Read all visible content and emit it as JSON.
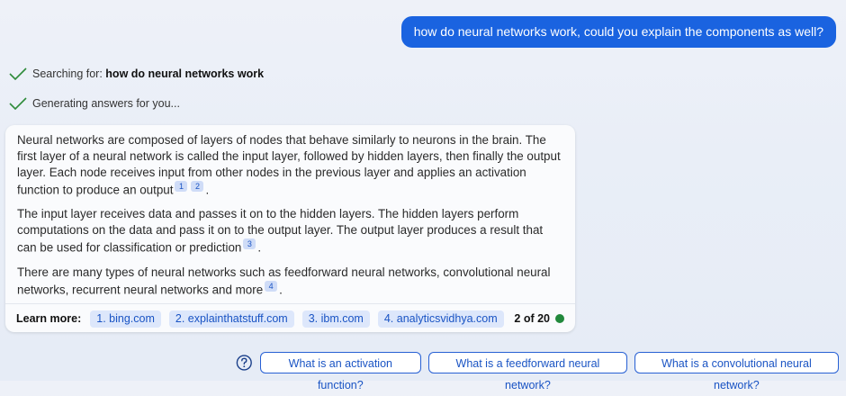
{
  "user_message": "how do neural networks work, could you explain the components as well?",
  "status": {
    "searching_prefix": "Searching for: ",
    "searching_query": "how do neural networks work",
    "generating": "Generating answers for you..."
  },
  "answer": {
    "p1": "Neural networks are composed of layers of nodes that behave similarly to neurons in the brain. The first layer of a neural network is called the input layer, followed by hidden layers, then finally the output layer. Each node receives input from other nodes in the previous layer and applies an activation function to produce an output",
    "p1_cites": [
      "1",
      "2"
    ],
    "p2": "The input layer receives data and passes it on to the hidden layers. The hidden layers perform computations on the data and pass it on to the output layer. The output layer produces a result that can be used for classification or prediction",
    "p2_cites": [
      "3"
    ],
    "p3": "There are many types of neural networks such as feedforward neural networks, convolutional neural networks, recurrent neural networks and more",
    "p3_cites": [
      "4"
    ],
    "period": "."
  },
  "learn_more": {
    "label": "Learn more:",
    "sources": [
      "1. bing.com",
      "2. explainthatstuff.com",
      "3. ibm.com",
      "4. analyticsvidhya.com"
    ],
    "counter": "2 of 20"
  },
  "suggestions": [
    "What is an activation function?",
    "What is a feedforward neural network?",
    "What is a convolutional neural network?"
  ],
  "colors": {
    "accent": "#1a63e0",
    "status_check": "#2e8b3a",
    "counter_dot": "#22893c"
  },
  "icons": {
    "status": "checkmark-icon",
    "help": "question-circle-icon"
  }
}
